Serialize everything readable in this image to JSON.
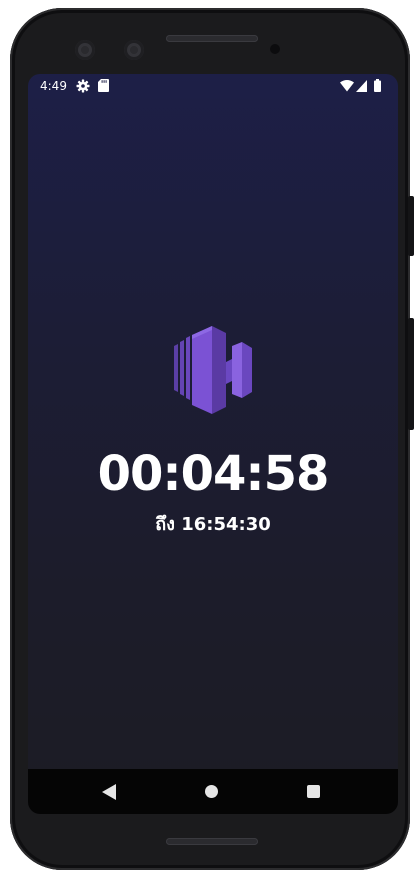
{
  "status_bar": {
    "time": "4:49",
    "icons": [
      "gear-icon",
      "sd-card-icon",
      "wifi-icon",
      "signal-icon",
      "battery-icon"
    ]
  },
  "app": {
    "logo": "h-logo-icon",
    "accent_color": "#7b52d4",
    "timer": "00:04:58",
    "until_text": "ถึง 16:54:30"
  },
  "nav_bar": {
    "buttons": [
      "back-icon",
      "home-icon",
      "recents-icon"
    ]
  }
}
